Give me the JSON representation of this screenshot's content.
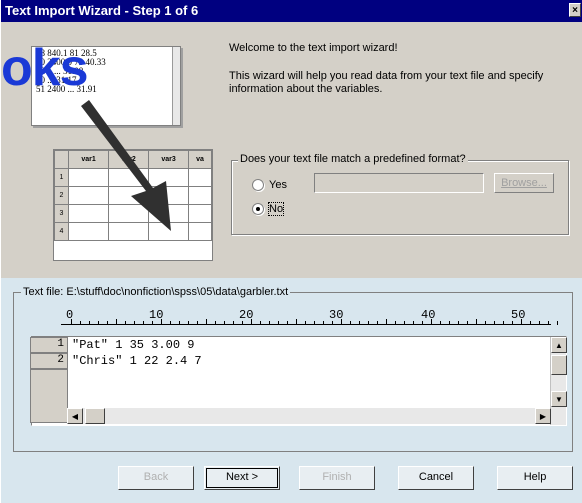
{
  "window": {
    "title": "Text Import Wizard - Step 1 of 6",
    "close_label": "×"
  },
  "watermark": {
    "text": "oks"
  },
  "illustration": {
    "paper_lines": [
      "28 840.1 81 28.5",
      "30 2400 0 73 40.33",
      "32 ...... 31.08",
      "70 ... 31.17",
      "51 2400 ... 31.91"
    ],
    "grid_headers": [
      "var1",
      "var2",
      "var3",
      "va"
    ],
    "grid_rows": [
      "1",
      "2",
      "3",
      "4"
    ]
  },
  "welcome": {
    "line1": "Welcome to the text import wizard!",
    "line2": "This wizard will help you read data from your text file and specify information about the variables."
  },
  "format_group": {
    "legend": "Does your text file match a predefined format?",
    "yes_label": "Yes",
    "no_label": "No",
    "selected": "No",
    "browse_label": "Browse..."
  },
  "preview": {
    "file_label": "Text file: E:\\stuff\\doc\\nonfiction\\spss\\05\\data\\garbler.txt",
    "ruler": [
      "0",
      "10",
      "20",
      "30",
      "40",
      "50"
    ],
    "rows": [
      {
        "num": "1",
        "text": "\"Pat\" 1 35 3.00 9"
      },
      {
        "num": "2",
        "text": "\"Chris\" 1 22 2.4 7"
      }
    ]
  },
  "buttons": {
    "back": "Back",
    "next": "Next >",
    "finish": "Finish",
    "cancel": "Cancel",
    "help": "Help"
  },
  "colors": {
    "titlebar": "#000080",
    "watermark": "#1a39d6",
    "arrow": "#303030"
  }
}
